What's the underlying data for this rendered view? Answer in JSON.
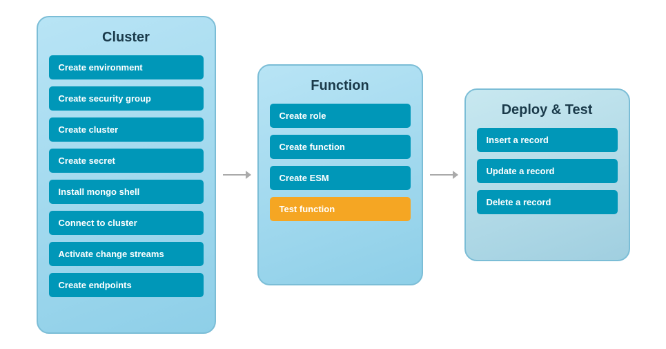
{
  "cluster": {
    "title": "Cluster",
    "steps": [
      "Create environment",
      "Create security group",
      "Create cluster",
      "Create secret",
      "Install mongo shell",
      "Connect to cluster",
      "Activate change streams",
      "Create endpoints"
    ]
  },
  "function": {
    "title": "Function",
    "steps": [
      {
        "label": "Create role",
        "style": "normal"
      },
      {
        "label": "Create function",
        "style": "normal"
      },
      {
        "label": "Create ESM",
        "style": "normal"
      },
      {
        "label": "Test function",
        "style": "orange"
      }
    ]
  },
  "deploy": {
    "title": "Deploy & Test",
    "steps": [
      "Insert a record",
      "Update a record",
      "Delete a record"
    ]
  },
  "arrows": {
    "arrow1": "→",
    "arrow2": "→"
  }
}
